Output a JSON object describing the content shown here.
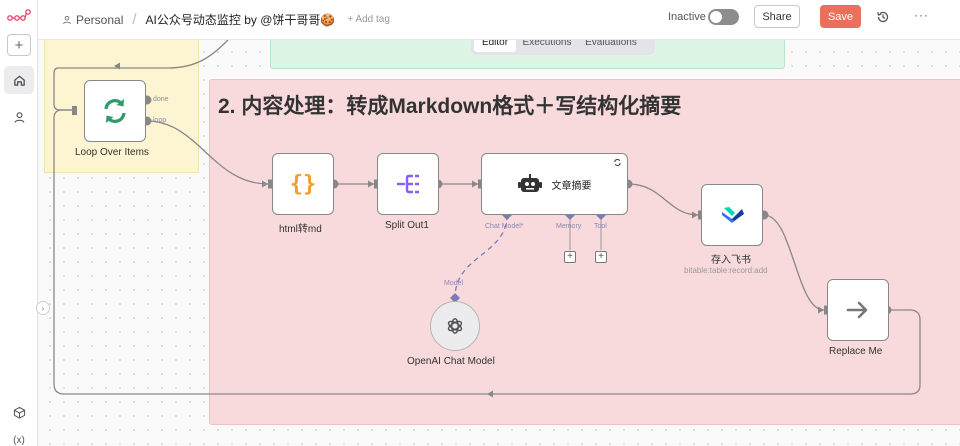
{
  "header": {
    "project": "Personal",
    "workflow_name": "AI公众号动态监控 by @饼干哥哥🍪",
    "add_tag": "+ Add tag",
    "status_label": "Inactive",
    "share_label": "Share",
    "save_label": "Save"
  },
  "tabs": [
    "Editor",
    "Executions",
    "Evaluations"
  ],
  "section": {
    "title": "2. 内容处理：转成Markdown格式＋写结构化摘要"
  },
  "nodes": {
    "loop": {
      "label": "Loop Over Items",
      "done": "done",
      "loop": "loop"
    },
    "html": {
      "label": "html转md"
    },
    "split": {
      "label": "Split Out1"
    },
    "agent": {
      "title": "文章摘要",
      "chat_model": "Chat Model*",
      "memory": "Memory",
      "tool": "Tool"
    },
    "feishu": {
      "label": "存入飞书",
      "sub": "bitable:table:record:add"
    },
    "openai": {
      "label": "OpenAI Chat Model",
      "port": "Model"
    },
    "replace": {
      "label": "Replace Me"
    }
  },
  "colors": {
    "accent": "#ea6f5d",
    "sticky_yellow": "#fdf4d2",
    "sticky_green": "#ddf5e4",
    "sticky_pink": "#f8dadd",
    "loop_icon": "#2f9a6a",
    "html_icon": "#f0a030",
    "split_icon": "#8b5cf6",
    "ai_port": "#7b7bb5"
  },
  "icons": {
    "logo": "n8n-logo-icon",
    "loop": "loop-refresh-icon",
    "html": "curly-braces-icon",
    "split": "split-out-icon",
    "agent": "robot-icon",
    "feishu": "feishu-lark-icon",
    "openai": "openai-icon",
    "replace": "arrow-right-icon"
  }
}
